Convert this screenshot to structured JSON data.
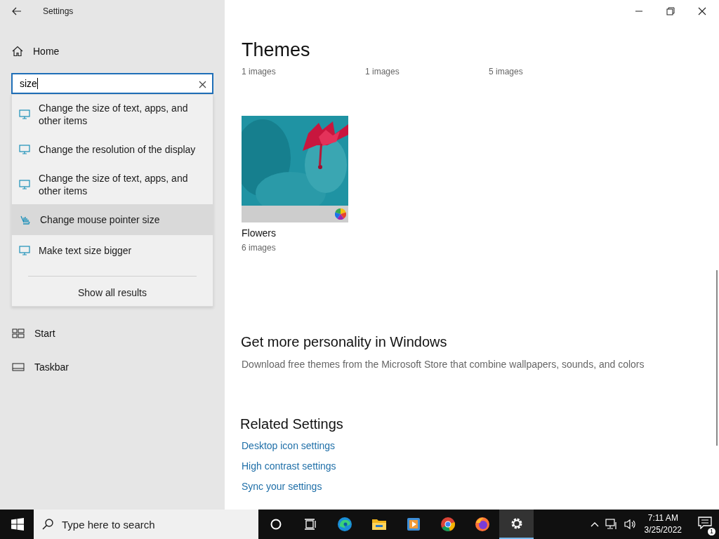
{
  "window": {
    "title": "Settings"
  },
  "sidebar": {
    "home": "Home",
    "items": [
      {
        "label": "Start",
        "kind": "start"
      },
      {
        "label": "Taskbar",
        "kind": "taskbar"
      }
    ]
  },
  "search": {
    "value": "size",
    "results": [
      {
        "label": "Change the size of text, apps, and other items",
        "kind": "display",
        "selected": false
      },
      {
        "label": "Change the resolution of the display",
        "kind": "display",
        "selected": false
      },
      {
        "label": "Change the size of text, apps, and other items",
        "kind": "display",
        "selected": false
      },
      {
        "label": "Change mouse pointer size",
        "kind": "mouse",
        "selected": true
      },
      {
        "label": "Make text size bigger",
        "kind": "display",
        "selected": false
      }
    ],
    "show_all": "Show all results"
  },
  "main": {
    "title": "Themes",
    "counts": [
      "1 images",
      "1 images",
      "5 images"
    ],
    "themes": [
      {
        "name": "Flowers",
        "count": "6 images",
        "kind": "picture"
      }
    ],
    "personality": {
      "title": "Get more personality in Windows",
      "text": "Download free themes from the Microsoft Store that combine wallpapers, sounds, and colors"
    },
    "related": {
      "title": "Related Settings",
      "links": [
        "Desktop icon settings",
        "High contrast settings",
        "Sync your settings"
      ]
    }
  },
  "taskbar": {
    "search_placeholder": "Type here to search",
    "apps": [
      {
        "kind": "cortana",
        "selected": false
      },
      {
        "kind": "taskview",
        "selected": false
      },
      {
        "kind": "edge",
        "selected": false
      },
      {
        "kind": "explorer",
        "selected": false
      },
      {
        "kind": "media",
        "selected": false
      },
      {
        "kind": "chrome",
        "selected": false
      },
      {
        "kind": "firefox",
        "selected": false
      },
      {
        "kind": "settings",
        "selected": true
      }
    ],
    "time": "7:11 AM",
    "date": "3/25/2022",
    "notifications": "1"
  }
}
